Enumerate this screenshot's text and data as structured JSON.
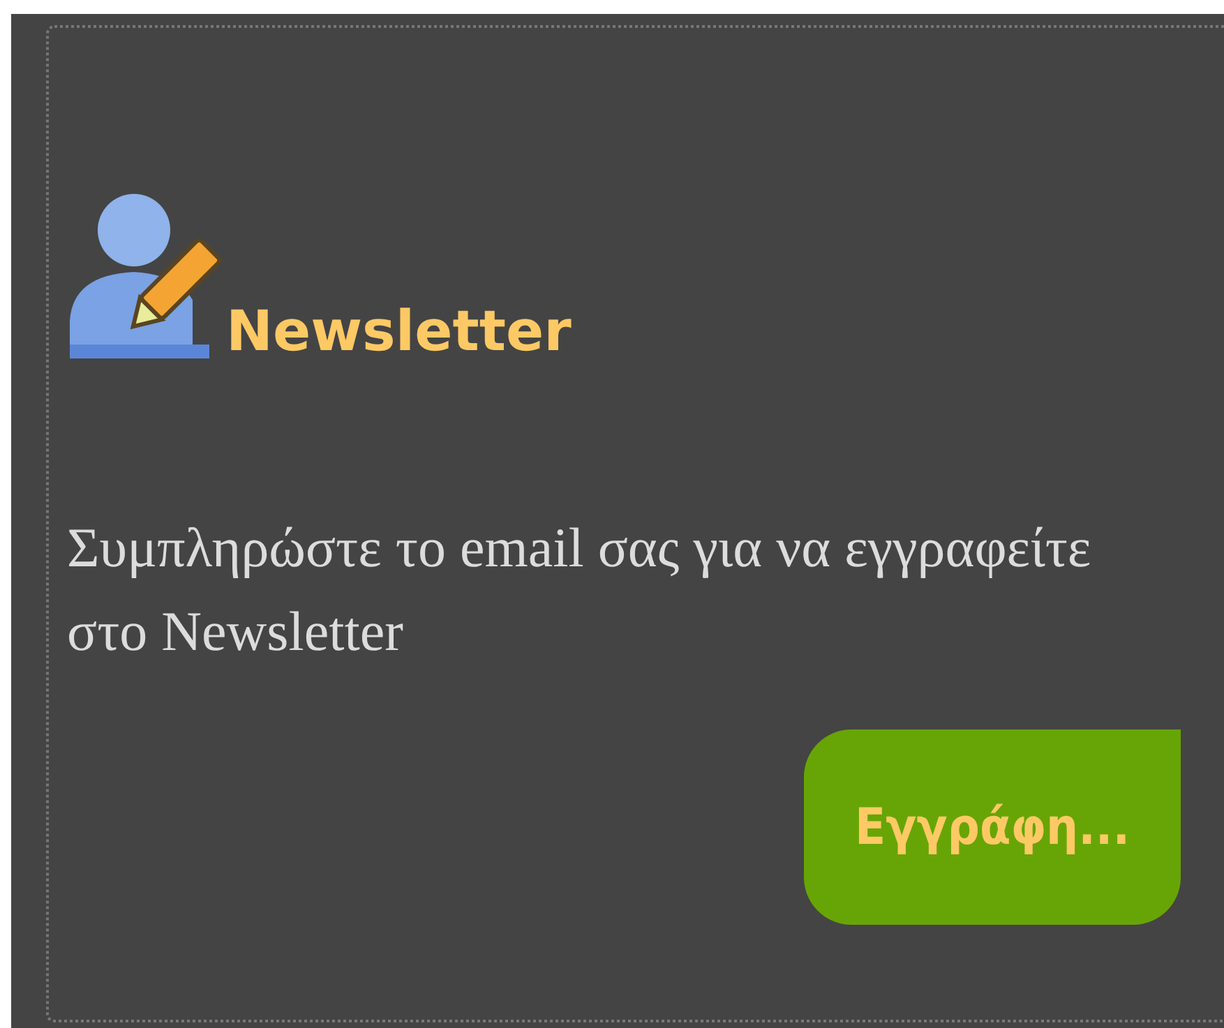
{
  "widget": {
    "title": "Newsletter",
    "text": "Συμπληρώστε το email σας για να εγγραφείτε στο Newsletter",
    "button": "Εγγράφη..."
  }
}
